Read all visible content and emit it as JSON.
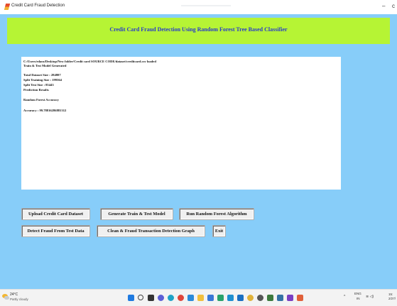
{
  "window": {
    "title": "Credit Card Fraud Detection",
    "minimize_glyph": "–",
    "overflow_glyph": "c"
  },
  "header": {
    "heading": "Credit Card Fraud Detection Using Random Forest Tree Based Classifier",
    "background": "#b6f434",
    "text_color": "#2a3cc9"
  },
  "output": {
    "lines": [
      "C:/Users/edara/Desktop/New folder/Credit card SOURCE CODE/dataset/creditcard.csv loaded",
      "Train & Test Model Generated",
      "Total Dataset Size : 284807",
      "Split Training Size : 199364",
      "Split Test Size : 85443",
      "Prediction Results",
      "Random Forest Accuracy",
      "Accuracy : 99.78816286881312"
    ]
  },
  "buttons": {
    "upload": "Upload Credit Card Dataset",
    "generate": "Generate Train & Test Model",
    "run": "Run Random Forest Algorithm",
    "detect": "Detect Fraud From Test Data",
    "graph": "Clean & Fraud Transaction Detection Graph",
    "exit": "Exit"
  },
  "page_background": "#87cdf9",
  "taskbar": {
    "weather_temp": "24°C",
    "weather_desc": "Partly cloudy",
    "icons": [
      {
        "name": "windows-start-icon",
        "color": "#1f7ae0"
      },
      {
        "name": "search-icon",
        "color": "#444444"
      },
      {
        "name": "task-view-icon",
        "color": "#333333"
      },
      {
        "name": "chat-icon",
        "color": "#5c5fd6"
      },
      {
        "name": "edge-icon",
        "color": "#1fa3c7"
      },
      {
        "name": "chrome-icon",
        "color": "#e0453a"
      },
      {
        "name": "vscode-icon",
        "color": "#2a8ad9"
      },
      {
        "name": "file-explorer-icon",
        "color": "#f2bf3c"
      },
      {
        "name": "store-icon",
        "color": "#3a78d6"
      },
      {
        "name": "mail-icon",
        "color": "#2aa36b"
      },
      {
        "name": "photos-icon",
        "color": "#1f8fd0"
      },
      {
        "name": "outlook-icon",
        "color": "#1a6fc2"
      },
      {
        "name": "chrome-alt-icon",
        "color": "#e0b23a"
      },
      {
        "name": "browser-icon",
        "color": "#555555"
      },
      {
        "name": "terminal-icon",
        "color": "#3d7a3d"
      },
      {
        "name": "python-icon",
        "color": "#3572a5"
      },
      {
        "name": "editor-icon",
        "color": "#7a3fc2"
      },
      {
        "name": "git-icon",
        "color": "#e0603a"
      }
    ],
    "tray_chevron": "^",
    "tray_lang_top": "ENG",
    "tray_lang_bottom": "IN",
    "tray_wifi_sound": "≋ ◁)",
    "clock_time": "15:",
    "clock_date": "2/27/"
  }
}
